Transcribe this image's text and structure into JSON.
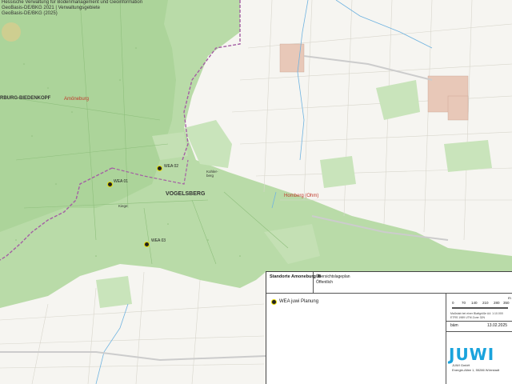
{
  "copyright_lines": [
    "Hessische Verwaltung für Bodenmanagement und Geoinformation",
    "GeoBasis-DE/BKG 2021 | Verwaltungsgebiete",
    "GeoBasis-DE/BKG (2025)"
  ],
  "region_labels": {
    "district": "RBURG-BIEDENKOPF",
    "town": "Amöneburg",
    "vogelsberg": "VOGELSBERG",
    "homberg": "Homberg (Ohm)",
    "kiege": "Kiege",
    "kohlberg": "Kohler-berg"
  },
  "turbines": [
    {
      "label": "WEA 01"
    },
    {
      "label": "WEA 02"
    },
    {
      "label": "WEA 03"
    }
  ],
  "legend": {
    "title": "Standorte Amoneburg III",
    "subtitle_1": "Übersichtslageplan",
    "subtitle_2": "Öffentlich",
    "entry": "WEA juwi Planung",
    "scale_numbers": [
      "0",
      "70",
      "140",
      "210",
      "280",
      "350"
    ],
    "scale_unit": "m",
    "note_1": "Maßstab bei einer Blattgröße A4: 1:10.000",
    "note_2": "ETRS 1989 UTM Zone 32N",
    "author": "bäm",
    "date": "13.02.2025",
    "logo": "JUWI",
    "company_1": "JUWI GmbH",
    "company_2": "Energie-Allee 1, 55286 Wörrstadt"
  }
}
